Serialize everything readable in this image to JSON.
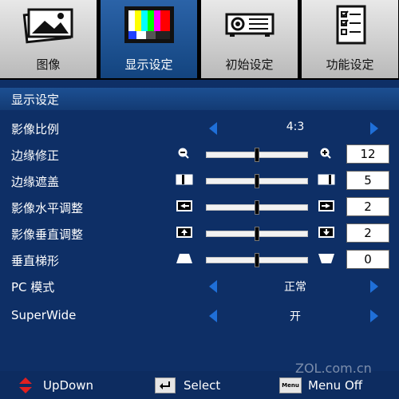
{
  "tabs": [
    {
      "label": "图像",
      "icon": "picture-icon",
      "active": false
    },
    {
      "label": "显示设定",
      "icon": "color-bars-icon",
      "active": true
    },
    {
      "label": "初始设定",
      "icon": "projector-icon",
      "active": false
    },
    {
      "label": "功能设定",
      "icon": "checklist-icon",
      "active": false
    }
  ],
  "section": {
    "title": "显示设定"
  },
  "rows": [
    {
      "label": "影像比例",
      "type": "select",
      "value": "4:3"
    },
    {
      "label": "边缘修正",
      "type": "slider",
      "value": "12",
      "left_icon": "zoom-out-icon",
      "right_icon": "zoom-in-icon",
      "level": 0.5
    },
    {
      "label": "边缘遮盖",
      "type": "slider",
      "value": "5",
      "left_icon": "mask-small-icon",
      "right_icon": "mask-large-icon",
      "level": 0.5
    },
    {
      "label": "影像水平调整",
      "type": "slider",
      "value": "2",
      "left_icon": "h-shift-left-icon",
      "right_icon": "h-shift-right-icon",
      "level": 0.5
    },
    {
      "label": "影像垂直调整",
      "type": "slider",
      "value": "2",
      "left_icon": "v-shift-up-icon",
      "right_icon": "v-shift-down-icon",
      "level": 0.5
    },
    {
      "label": "垂直梯形",
      "type": "slider",
      "value": "0",
      "left_icon": "keystone-top-icon",
      "right_icon": "keystone-bottom-icon",
      "level": 0.5
    },
    {
      "label": "PC 模式",
      "type": "select",
      "value": "正常"
    },
    {
      "label": "SuperWide",
      "type": "select",
      "value": "开"
    }
  ],
  "footer": {
    "updown": "UpDown",
    "select": "Select",
    "menu_off": "Menu Off",
    "menu_icon_text": "Menu"
  },
  "watermark": "ZOL.com.cn",
  "colors": {
    "active_tab": "#1e5296",
    "panel_bg": "#0e2f66",
    "arrow": "#1f6fd8",
    "updown_red": "#e02020"
  }
}
